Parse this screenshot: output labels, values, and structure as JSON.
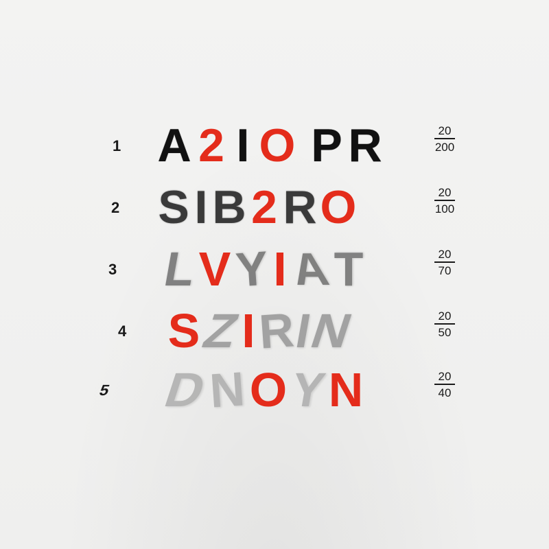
{
  "colors": {
    "background": "#f1f1f0",
    "ink": "#111111",
    "accent": "#e42c1b"
  },
  "rows": [
    {
      "number": "1",
      "letters": [
        {
          "char": "A",
          "accent": false
        },
        {
          "char": "2",
          "accent": true
        },
        {
          "char": "I",
          "accent": false
        },
        {
          "char": "O",
          "accent": true
        },
        {
          "char": "P",
          "accent": false
        },
        {
          "char": "R",
          "accent": false
        }
      ],
      "acuity": {
        "numerator": "20",
        "denominator": "200"
      }
    },
    {
      "number": "2",
      "letters": [
        {
          "char": "S",
          "accent": false
        },
        {
          "char": "I",
          "accent": false
        },
        {
          "char": "B",
          "accent": false
        },
        {
          "char": "2",
          "accent": true
        },
        {
          "char": "R",
          "accent": false
        },
        {
          "char": "O",
          "accent": true
        }
      ],
      "acuity": {
        "numerator": "20",
        "denominator": "100"
      }
    },
    {
      "number": "3",
      "letters": [
        {
          "char": "L",
          "accent": false
        },
        {
          "char": "V",
          "accent": true
        },
        {
          "char": "Y",
          "accent": false
        },
        {
          "char": "I",
          "accent": true
        },
        {
          "char": "A",
          "accent": false
        },
        {
          "char": "T",
          "accent": false
        }
      ],
      "acuity": {
        "numerator": "20",
        "denominator": "70"
      }
    },
    {
      "number": "4",
      "letters": [
        {
          "char": "S",
          "accent": true
        },
        {
          "char": "Z",
          "accent": false
        },
        {
          "char": "I",
          "accent": true
        },
        {
          "char": "R",
          "accent": false
        },
        {
          "char": "I",
          "accent": false
        },
        {
          "char": "N",
          "accent": false
        }
      ],
      "acuity": {
        "numerator": "20",
        "denominator": "50"
      }
    },
    {
      "number": "5",
      "letters": [
        {
          "char": "D",
          "accent": false
        },
        {
          "char": "N",
          "accent": false
        },
        {
          "char": "O",
          "accent": true
        },
        {
          "char": "Y",
          "accent": false
        },
        {
          "char": "N",
          "accent": true
        }
      ],
      "acuity": {
        "numerator": "20",
        "denominator": "40"
      }
    }
  ]
}
